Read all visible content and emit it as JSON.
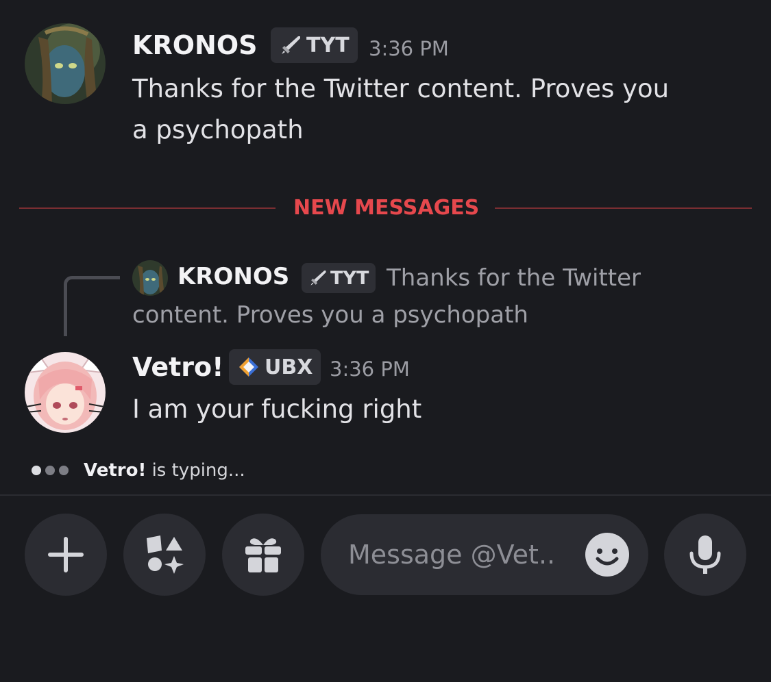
{
  "colors": {
    "background": "#1a1b1f",
    "new_messages_accent": "#e6484d",
    "pill_background": "#2b2c32"
  },
  "messages": [
    {
      "username": "KRONOS",
      "tag": {
        "icon": "sword-icon",
        "label": "TYT"
      },
      "timestamp": "3:36 PM",
      "text_line1": "Thanks for the Twitter content. Proves you",
      "text_line2": "a psychopath"
    },
    {
      "username": "Vetro!",
      "tag": {
        "icon": "diamond-sparkle-icon",
        "label": "UBX"
      },
      "timestamp": "3:36 PM",
      "reply": {
        "username": "KRONOS",
        "tag_label": "TYT",
        "text_line1": "Thanks for the Twitter",
        "text_line2": "content. Proves you a psychopath"
      },
      "text": "I am your fucking right"
    }
  ],
  "divider": {
    "label": "NEW MESSAGES"
  },
  "typing": {
    "name": "Vetro!",
    "suffix": " is typing..."
  },
  "composer": {
    "placeholder": "Message @Vet..",
    "buttons": [
      "plus-icon",
      "apps-icon",
      "gift-icon",
      "emoji-icon",
      "microphone-icon"
    ]
  }
}
